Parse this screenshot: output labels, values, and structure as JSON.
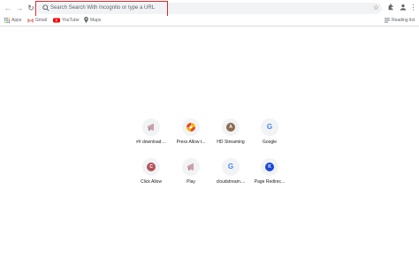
{
  "omnibox": {
    "placeholder": "Search Search With Incognito or type a URL"
  },
  "bookmarks": {
    "items": [
      {
        "label": "Apps",
        "icon": "apps-grid-icon"
      },
      {
        "label": "Gmail",
        "icon": "gmail-icon"
      },
      {
        "label": "YouTube",
        "icon": "youtube-icon"
      },
      {
        "label": "Maps",
        "icon": "maps-pin-icon"
      }
    ],
    "reading_list": "Reading list"
  },
  "shortcuts": [
    {
      "label": "## download ...",
      "icon": "megaphone-icon",
      "glyph": "",
      "color": "#c9a0a8"
    },
    {
      "label": "Press Allow t...",
      "icon": "pinwheel-icon",
      "glyph": "",
      "color": "#f5b400"
    },
    {
      "label": "HD Streaming",
      "icon": "letter-a-icon",
      "glyph": "A",
      "color": "#8a6d4e"
    },
    {
      "label": "Google",
      "icon": "google-icon",
      "glyph": "G",
      "color": "#4285f4"
    },
    {
      "label": "Click Allow",
      "icon": "letter-c-icon",
      "glyph": "C",
      "color": "#b5525c"
    },
    {
      "label": "Play",
      "icon": "megaphone-icon",
      "glyph": "",
      "color": "#c9a0a8"
    },
    {
      "label": "cloudstream....",
      "icon": "google-icon",
      "glyph": "G",
      "color": "#4285f4"
    },
    {
      "label": "Page Redirec...",
      "icon": "letter-k-icon",
      "glyph": "K",
      "color": "#1a47d6"
    }
  ],
  "colors": {
    "highlight": "#e0262b",
    "omnibox_bg": "#f1f3f4",
    "tile_bg": "#f1f3f4"
  }
}
